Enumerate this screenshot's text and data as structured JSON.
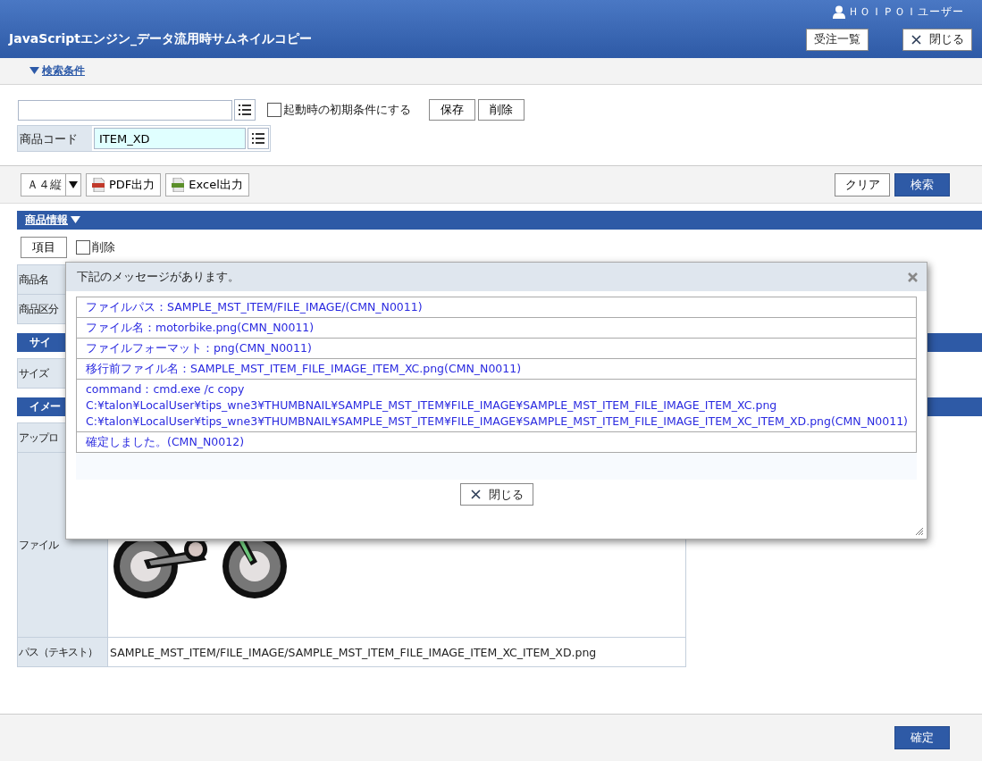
{
  "header": {
    "user": "ＨＯＩＰＯＩユーザー",
    "title": "JavaScriptエンジン_データ流用時サムネイルコピー",
    "buttons": [
      {
        "label": "受注一覧",
        "kind": "plain"
      },
      {
        "label": "閉じる",
        "kind": "close"
      }
    ]
  },
  "search_toggle": {
    "label": "検索条件",
    "expanded": true
  },
  "conditions": {
    "startup_default": {
      "label": "起動時の初期条件にする",
      "checked": false
    },
    "buttons": [
      "保存",
      "削除"
    ],
    "fields": [
      {
        "label": "商品コード",
        "value": "ITEM_XD"
      }
    ]
  },
  "toolbar": {
    "paper": "Ａ４縦",
    "exports": [
      {
        "label": "PDF出力",
        "kind": "pdf"
      },
      {
        "label": "Excel出力",
        "kind": "excel"
      }
    ],
    "actions": [
      {
        "label": "クリア",
        "primary": false
      },
      {
        "label": "検索",
        "primary": true
      }
    ]
  },
  "product_section": {
    "title": "商品情報",
    "expanded": true,
    "item_button": "項目",
    "delete_option": {
      "label": "削除",
      "checked": false
    },
    "rows": [
      {
        "label": "商品名"
      },
      {
        "label": "商品区分"
      }
    ]
  },
  "sections": [
    {
      "title": "サイ",
      "rows": [
        {
          "label": "サイズ"
        }
      ]
    },
    {
      "title": "イメー",
      "rows": [
        {
          "label": "アップロ"
        },
        {
          "label": "ファイル"
        },
        {
          "label": "パス（テキスト）",
          "value": "SAMPLE_MST_ITEM/FILE_IMAGE/SAMPLE_MST_ITEM_FILE_IMAGE_ITEM_XC_ITEM_XD.png"
        }
      ]
    }
  ],
  "footer": {
    "confirm": "確定"
  },
  "dialog": {
    "title": "下記のメッセージがあります。",
    "messages": [
      [
        "ファイルパス：SAMPLE_MST_ITEM/FILE_IMAGE/(CMN_N0011)"
      ],
      [
        "ファイル名：motorbike.png(CMN_N0011)"
      ],
      [
        "ファイルフォーマット：png(CMN_N0011)"
      ],
      [
        "移行前ファイル名：SAMPLE_MST_ITEM_FILE_IMAGE_ITEM_XC.png(CMN_N0011)"
      ],
      [
        "command：cmd.exe /c copy",
        "C:¥talon¥LocalUser¥tips_wne3¥THUMBNAIL¥SAMPLE_MST_ITEM¥FILE_IMAGE¥SAMPLE_MST_ITEM_FILE_IMAGE_ITEM_XC.png",
        "C:¥talon¥LocalUser¥tips_wne3¥THUMBNAIL¥SAMPLE_MST_ITEM¥FILE_IMAGE¥SAMPLE_MST_ITEM_FILE_IMAGE_ITEM_XC_ITEM_XD.png(CMN_N0011)"
      ],
      [
        "確定しました。(CMN_N0012)"
      ]
    ],
    "close_button": "閉じる"
  }
}
